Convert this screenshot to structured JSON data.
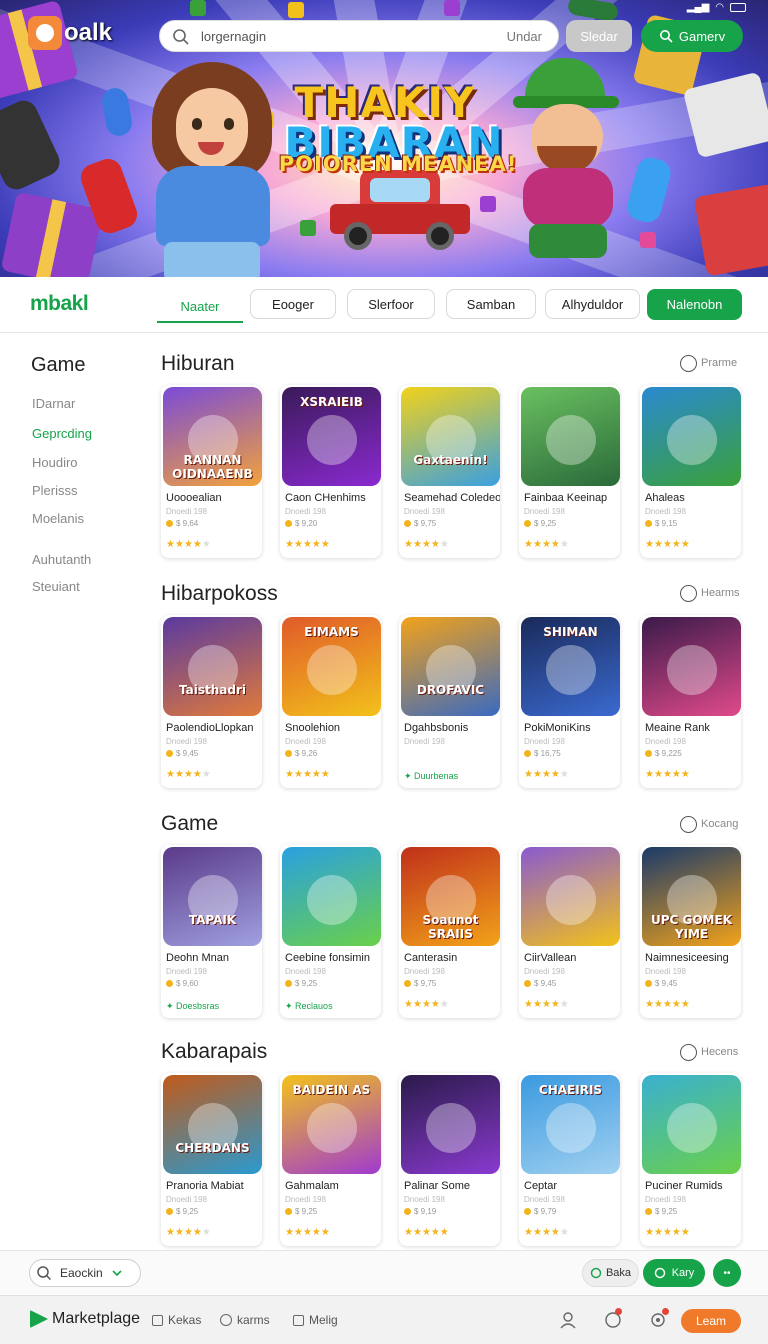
{
  "status_bar": {
    "icons": [
      "signal-icon",
      "wifi-icon",
      "battery-icon"
    ]
  },
  "header": {
    "logo_text": "oalk",
    "search_placeholder": "lorgernagin",
    "search_right": "Undar",
    "gray_button": "Sledar",
    "green_button": "Gamerv"
  },
  "hero": {
    "title_line1": "THAKIY",
    "title_line2": "BIBARAN",
    "title_line3": "POIOREN MEANEA!"
  },
  "nav": {
    "brand": "mbakl",
    "active_tab": "Naater",
    "tabs": [
      "Eooger",
      "Slerfoor",
      "Samban",
      "Alhyduldor"
    ],
    "cta": "Nalenobn"
  },
  "sidebar": {
    "title": "Game",
    "items": [
      "IDarnar",
      "Geprcding",
      "Houdiro",
      "Plerisss",
      "Moelanis",
      "Auhutanth",
      "Steuiant"
    ],
    "active_index": 1
  },
  "sections": [
    {
      "title": "Hiburan",
      "more": "Prarme",
      "cards": [
        {
          "thumb": "RANNAN OIDNAAENB",
          "name": "Uoooealian",
          "sub": "Dnoedi 198",
          "price": "$ 9,64",
          "rating": 4
        },
        {
          "thumb": "XSRAIEIB",
          "name": "Caon CHenhims",
          "sub": "Dnoedi 198",
          "price": "$ 9,20",
          "rating": 5
        },
        {
          "thumb": "Gaxtaenin!",
          "name": "Seamehad Coledeo",
          "sub": "Dnoedi 198",
          "price": "$ 9,75",
          "rating": 4
        },
        {
          "thumb": "",
          "name": "Fainbaa Keeinap",
          "sub": "Dnoedi 198",
          "price": "$ 9,25",
          "rating": 4
        },
        {
          "thumb": "",
          "name": "Ahaleas",
          "sub": "Dnoedi 198",
          "price": "$ 9,15",
          "rating": 5
        }
      ]
    },
    {
      "title": "Hibarpokoss",
      "more": "Hearms",
      "cards": [
        {
          "thumb": "Taisthadri",
          "name": "PaolendioLlopkan",
          "sub": "Dnoedi 198",
          "price": "$ 9,45",
          "rating": 4
        },
        {
          "thumb": "EIMAMS",
          "name": "Snoolehion",
          "sub": "Dnoedi 198",
          "price": "$ 9,26",
          "rating": 5
        },
        {
          "thumb": "DROFAVIC",
          "name": "Dgahbsbonis",
          "sub": "Dnoedi 198",
          "price": "",
          "badge": "Duurbenas"
        },
        {
          "thumb": "SHIMAN",
          "name": "PokiMoniKins",
          "sub": "Dnoedi 198",
          "price": "$ 16,75",
          "rating": 4
        },
        {
          "thumb": "",
          "name": "Meaine Rank",
          "sub": "Dnoedi 198",
          "price": "$ 9,225",
          "rating": 5
        }
      ]
    },
    {
      "title": "Game",
      "more": "Kocang",
      "cards": [
        {
          "thumb": "TAPAIK",
          "name": "Deohn Mnan",
          "sub": "Dnoedi 198",
          "price": "$ 9,60",
          "badge": "Doesbsras"
        },
        {
          "thumb": "",
          "name": "Ceebine fonsimin",
          "sub": "Dnoedi 198",
          "price": "$ 9,25",
          "badge": "Reclauos"
        },
        {
          "thumb": "Soaunot SRAIIS",
          "name": "Canterasin",
          "sub": "Dnoedi 198",
          "price": "$ 9,75",
          "rating": 4
        },
        {
          "thumb": "",
          "name": "CiirVallean",
          "sub": "Dnoedi 198",
          "price": "$ 9,45",
          "rating": 4
        },
        {
          "thumb": "UPC GOMEK YIME",
          "name": "Naimnesiceesing",
          "sub": "Dnoedi 198",
          "price": "$ 9,45",
          "rating": 5
        }
      ]
    },
    {
      "title": "Kabarapais",
      "more": "Hecens",
      "cards": [
        {
          "thumb": "CHERDANS",
          "name": "Pranoria Mabiat",
          "sub": "Dnoedi 198",
          "price": "$ 9,25",
          "rating": 4
        },
        {
          "thumb": "BAIDEIN AS",
          "name": "Gahmalam",
          "sub": "Dnoedi 198",
          "price": "$ 9,25",
          "rating": 5
        },
        {
          "thumb": "",
          "name": "Palinar Some",
          "sub": "Dnoedi 198",
          "price": "$ 9,19",
          "rating": 5
        },
        {
          "thumb": "CHAEIRIS",
          "name": "Ceptar",
          "sub": "Dnoedi 198",
          "price": "$ 9,79",
          "rating": 4
        },
        {
          "thumb": "",
          "name": "Puciner Rumids",
          "sub": "Dnoedi 198",
          "price": "$ 9,25",
          "rating": 5
        }
      ]
    }
  ],
  "filterbar": {
    "select_label": "Eaockin",
    "pill_light": "Baka",
    "pill_green": "Kary",
    "round": "••"
  },
  "footer": {
    "brand": "Marketplage",
    "items": [
      "Kekas",
      "karms",
      "Melig"
    ],
    "button": "Leam"
  },
  "colors": {
    "accent": "#16a34a",
    "orange": "#f07a2a",
    "star": "#f2b41a"
  }
}
